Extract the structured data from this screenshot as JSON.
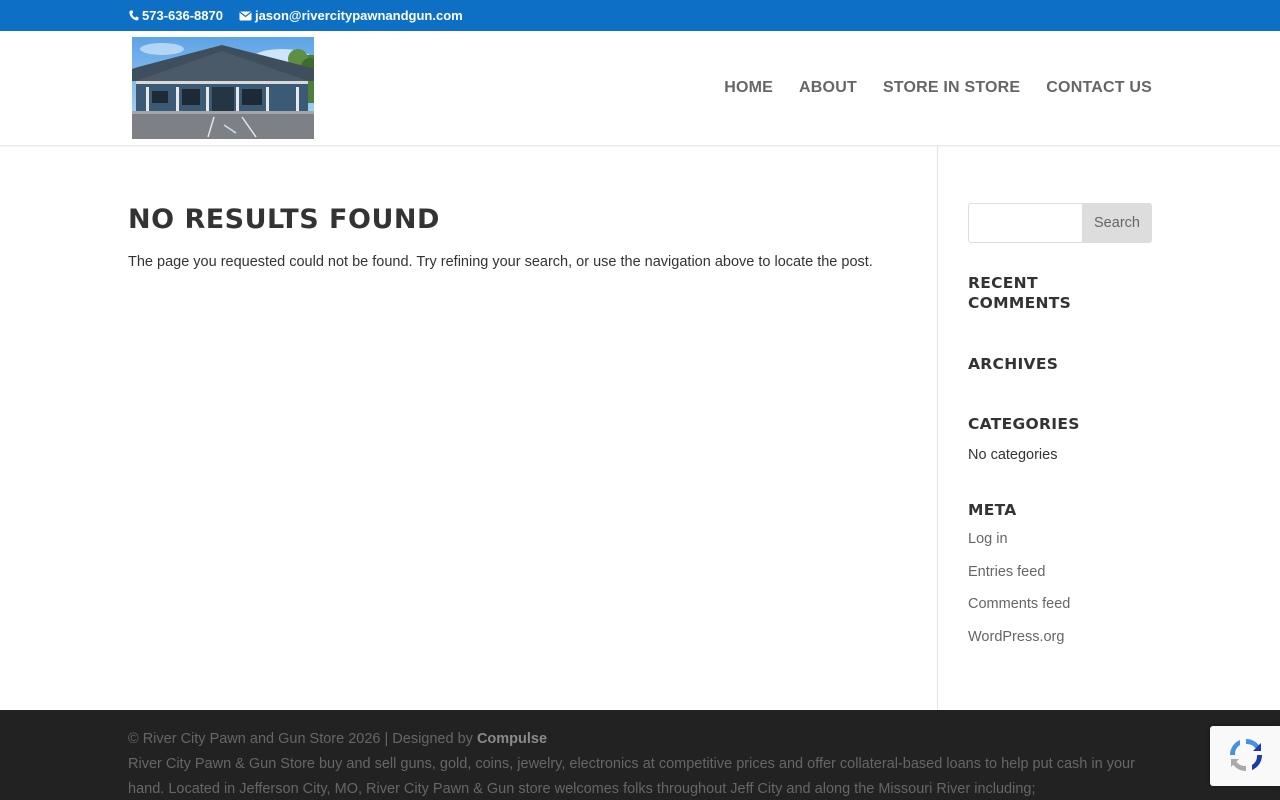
{
  "top_bar": {
    "phone": "573-636-8870",
    "email": "jason@rivercitypawnandgun.com"
  },
  "nav": {
    "items": [
      "HOME",
      "ABOUT",
      "STORE IN STORE",
      "CONTACT US"
    ]
  },
  "main": {
    "title": "NO RESULTS FOUND",
    "message": "The page you requested could not be found. Try refining your search, or use the navigation above to locate the post."
  },
  "sidebar": {
    "search_button": "Search",
    "recent_comments_title": "RECENT COMMENTS",
    "archives_title": "ARCHIVES",
    "categories_title": "CATEGORIES",
    "categories_empty": "No categories",
    "meta_title": "META",
    "meta_links": [
      "Log in",
      "Entries feed",
      "Comments feed",
      "WordPress.org"
    ]
  },
  "footer": {
    "copyright": "© River City Pawn and Gun Store 2026 | Designed by ",
    "designer": "Compulse",
    "description": "River City Pawn & Gun Store buy and sell guns, gold, coins, jewelry, electronics at competitive prices and offer collateral-based loans to help put cash in your hand. Located in Jefferson City, MO, River City Pawn & Gun store welcomes folks throughout Jeff City and along the Missouri River including;"
  },
  "colors": {
    "top_bar": "#0e70c4",
    "footer": "#222222",
    "heading": "#333333",
    "text": "#666666"
  }
}
